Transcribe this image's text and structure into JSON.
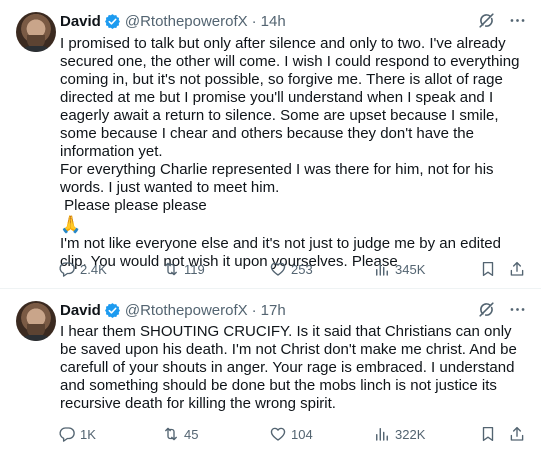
{
  "colors": {
    "text": "#0f1419",
    "secondary": "#536471",
    "verified": "#1d9bf0",
    "border": "#eff3f4"
  },
  "tweets": [
    {
      "author": {
        "name": "David",
        "handle": "@RtothepowerofX",
        "verified": true
      },
      "separator": "·",
      "time": "14h",
      "paragraphs": [
        "I promised to talk but only after silence and only to two. I've already secured one, the other will come. I wish I could respond to everything coming in, but it's not possible, so forgive me. There is allot of rage directed at me but I promise you'll understand when I speak and I eagerly await a return to silence. Some are upset because I smile, some because I chear and others because they don't have the information yet.",
        "For everything Charlie represented I was there for him, not for his words. I just wanted to meet him.",
        " Please please please",
        "🙏",
        "I'm not like everyone else and it's not just to judge me by an edited clip. You would not wish it upon yourselves. Please"
      ],
      "stats": {
        "replies": "2.4K",
        "reposts": "119",
        "likes": "253",
        "views": "345K"
      }
    },
    {
      "author": {
        "name": "David",
        "handle": "@RtothepowerofX",
        "verified": true
      },
      "separator": "·",
      "time": "17h",
      "paragraphs": [
        "I hear them SHOUTING CRUCIFY. Is it said that Christians can only be saved upon his death. I'm not Christ don't make me christ. And be carefull of your shouts in anger. Your rage is embraced. I understand and something should be done but the mobs linch is not justice its recursive death for killing the wrong spirit."
      ],
      "stats": {
        "replies": "1K",
        "reposts": "45",
        "likes": "104",
        "views": "322K"
      }
    }
  ],
  "icons": [
    "grok-icon",
    "more-icon",
    "reply-icon",
    "repost-icon",
    "like-icon",
    "views-icon",
    "bookmark-icon",
    "share-icon"
  ]
}
